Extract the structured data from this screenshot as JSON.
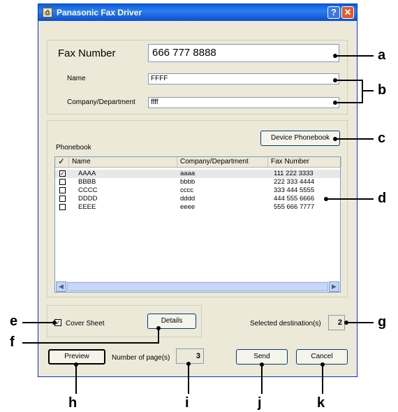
{
  "window": {
    "title": "Panasonic Fax Driver",
    "help_glyph": "?",
    "close_glyph": "✕"
  },
  "fax": {
    "label": "Fax Number",
    "value": "666 777 8888"
  },
  "name": {
    "label": "Name",
    "value": "FFFF"
  },
  "company": {
    "label": "Company/Department",
    "value": "ffff"
  },
  "phonebook": {
    "label": "Phonebook",
    "device_button": "Device Phonebook",
    "columns": [
      "✓",
      "Name",
      "Company/Department",
      "Fax Number"
    ],
    "rows": [
      {
        "checked": true,
        "name": "AAAA",
        "company": "aaaa",
        "fax": "111 222 3333"
      },
      {
        "checked": false,
        "name": "BBBB",
        "company": "bbbb",
        "fax": "222 333 4444"
      },
      {
        "checked": false,
        "name": "CCCC",
        "company": "cccc",
        "fax": "333 444 5555"
      },
      {
        "checked": false,
        "name": "DDDD",
        "company": "dddd",
        "fax": "444 555 6666"
      },
      {
        "checked": false,
        "name": "EEEE",
        "company": "eeee",
        "fax": "555 666 7777"
      }
    ],
    "scroll_left": "◀",
    "scroll_right": "▶"
  },
  "cover_sheet": {
    "label": "Cover Sheet",
    "checked": true,
    "details_button": "Details"
  },
  "selected": {
    "label": "Selected destination(s)",
    "value": "2"
  },
  "pages": {
    "label": "Number of page(s)",
    "value": "3"
  },
  "buttons": {
    "preview": "Preview",
    "send": "Send",
    "cancel": "Cancel"
  },
  "callouts": {
    "a": "a",
    "b": "b",
    "c": "c",
    "d": "d",
    "e": "e",
    "f": "f",
    "g": "g",
    "h": "h",
    "i": "i",
    "j": "j",
    "k": "k"
  }
}
